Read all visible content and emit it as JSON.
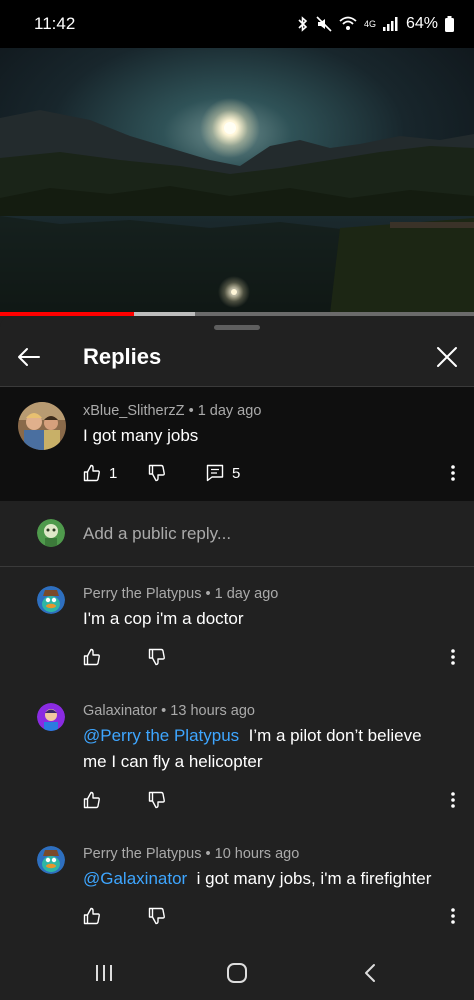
{
  "status_bar": {
    "time": "11:42",
    "network": "4G",
    "battery": "64%",
    "icons": [
      "bluetooth-icon",
      "mute-icon",
      "wifi-icon",
      "signal-icon",
      "battery-icon"
    ]
  },
  "video": {
    "progress_played": 0.283,
    "progress_buffered": 0.411
  },
  "panel": {
    "title": "Replies",
    "back_icon": "arrow-left-icon",
    "close_icon": "close-icon"
  },
  "parent_comment": {
    "author": "xBlue_SlitherzZ",
    "time": "1 day ago",
    "text": "I got many jobs",
    "likes": "1",
    "replies": "5"
  },
  "reply_box": {
    "placeholder": "Add a public reply..."
  },
  "replies": [
    {
      "author": "Perry the Platypus",
      "time": "1 day ago",
      "text": "I'm a cop i'm a doctor"
    },
    {
      "author": "Galaxinator",
      "time": "13 hours ago",
      "mention": "@Perry the Platypus",
      "text_line1": "  I’m a pilot don’t believe",
      "text_line2": "me I can fly a helicopter"
    },
    {
      "author": "Perry the Platypus",
      "time": "10 hours ago",
      "mention": "@Galaxinator",
      "text": "  i got many jobs, i'm a firefighter"
    }
  ],
  "colors": {
    "background": "#212121",
    "parent_background": "#0f0f0f",
    "mention": "#3ea6ff",
    "progress": "#ff0000",
    "secondary_text": "#aaaaaa"
  },
  "nav": {
    "icons": [
      "recent-apps-icon",
      "home-icon",
      "back-icon"
    ]
  }
}
